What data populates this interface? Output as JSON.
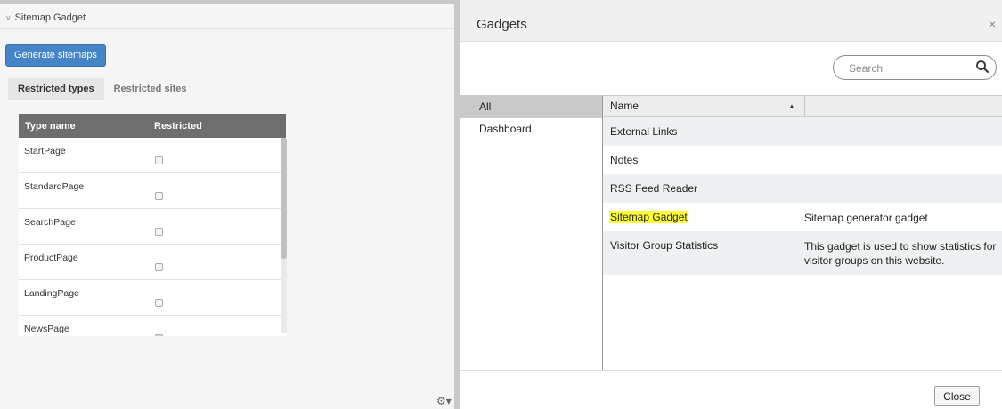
{
  "gadget": {
    "title": "Sitemap Gadget",
    "generate_label": "Generate sitemaps",
    "tabs": [
      {
        "label": "Restricted types",
        "active": true
      },
      {
        "label": "Restricted sites",
        "active": false
      }
    ],
    "table": {
      "headers": [
        "Type name",
        "Restricted"
      ],
      "rows": [
        {
          "name": "StartPage",
          "restricted": false
        },
        {
          "name": "StandardPage",
          "restricted": false
        },
        {
          "name": "SearchPage",
          "restricted": false
        },
        {
          "name": "ProductPage",
          "restricted": false
        },
        {
          "name": "LandingPage",
          "restricted": false
        },
        {
          "name": "NewsPage",
          "restricted": true
        }
      ]
    },
    "icons": {
      "collapse": "chevron-down-icon",
      "settings": "gear-icon"
    }
  },
  "dialog": {
    "title": "Gadgets",
    "close_symbol": "×",
    "search_placeholder": "Search",
    "categories": [
      {
        "label": "All",
        "selected": true
      },
      {
        "label": "Dashboard",
        "selected": false
      }
    ],
    "columns": {
      "name": "Name",
      "sort": "▲"
    },
    "rows": [
      {
        "name": "External Links",
        "description": ""
      },
      {
        "name": "Notes",
        "description": ""
      },
      {
        "name": "RSS Feed Reader",
        "description": ""
      },
      {
        "name": "Sitemap Gadget",
        "description": "Sitemap generator gadget",
        "highlight": true
      },
      {
        "name": "Visitor Group Statistics",
        "description": "This gadget is used to show statistics for",
        "description_line2": "visitor groups on this website."
      }
    ],
    "close_label": "Close",
    "colors": {
      "highlight": "#ffff33",
      "primary_button": "#4584c6"
    }
  }
}
